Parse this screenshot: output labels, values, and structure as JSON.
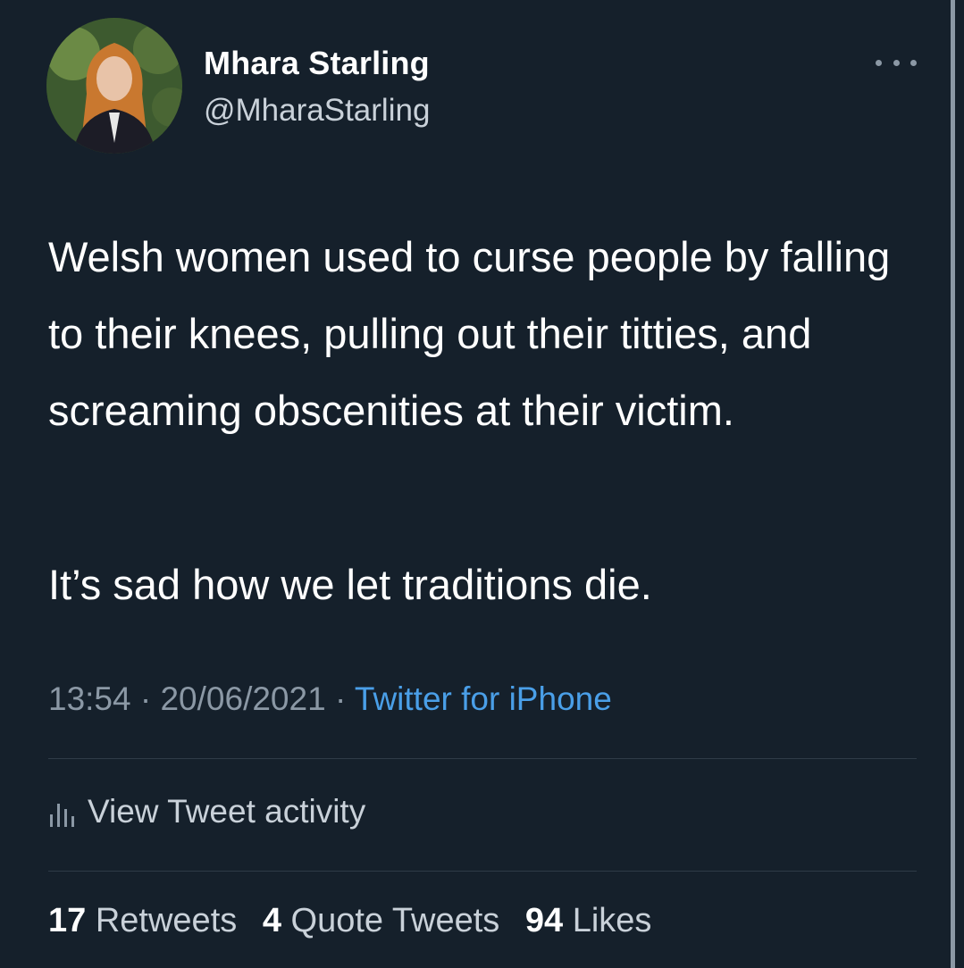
{
  "author": {
    "name": "Mhara Starling",
    "handle": "@MharaStarling"
  },
  "tweet": {
    "text": "Welsh women used to curse people by falling to their knees, pulling out their titties, and screaming obscenities at their victim.",
    "text2": "It’s sad how we let traditions die.",
    "time": "13:54",
    "date": "20/06/2021",
    "source": "Twitter for iPhone",
    "sep1": " · ",
    "sep2": " · "
  },
  "activity_label": "View Tweet activity",
  "stats": {
    "retweets_count": "17",
    "retweets_label": "Retweets",
    "quotes_count": "4",
    "quotes_label": "Quote Tweets",
    "likes_count": "94",
    "likes_label": "Likes"
  },
  "icons": {
    "more": "more-horizontal-icon",
    "activity": "bar-chart-icon"
  },
  "colors": {
    "background": "#15202b",
    "link": "#4a9fe8",
    "muted": "#8b98a5"
  }
}
